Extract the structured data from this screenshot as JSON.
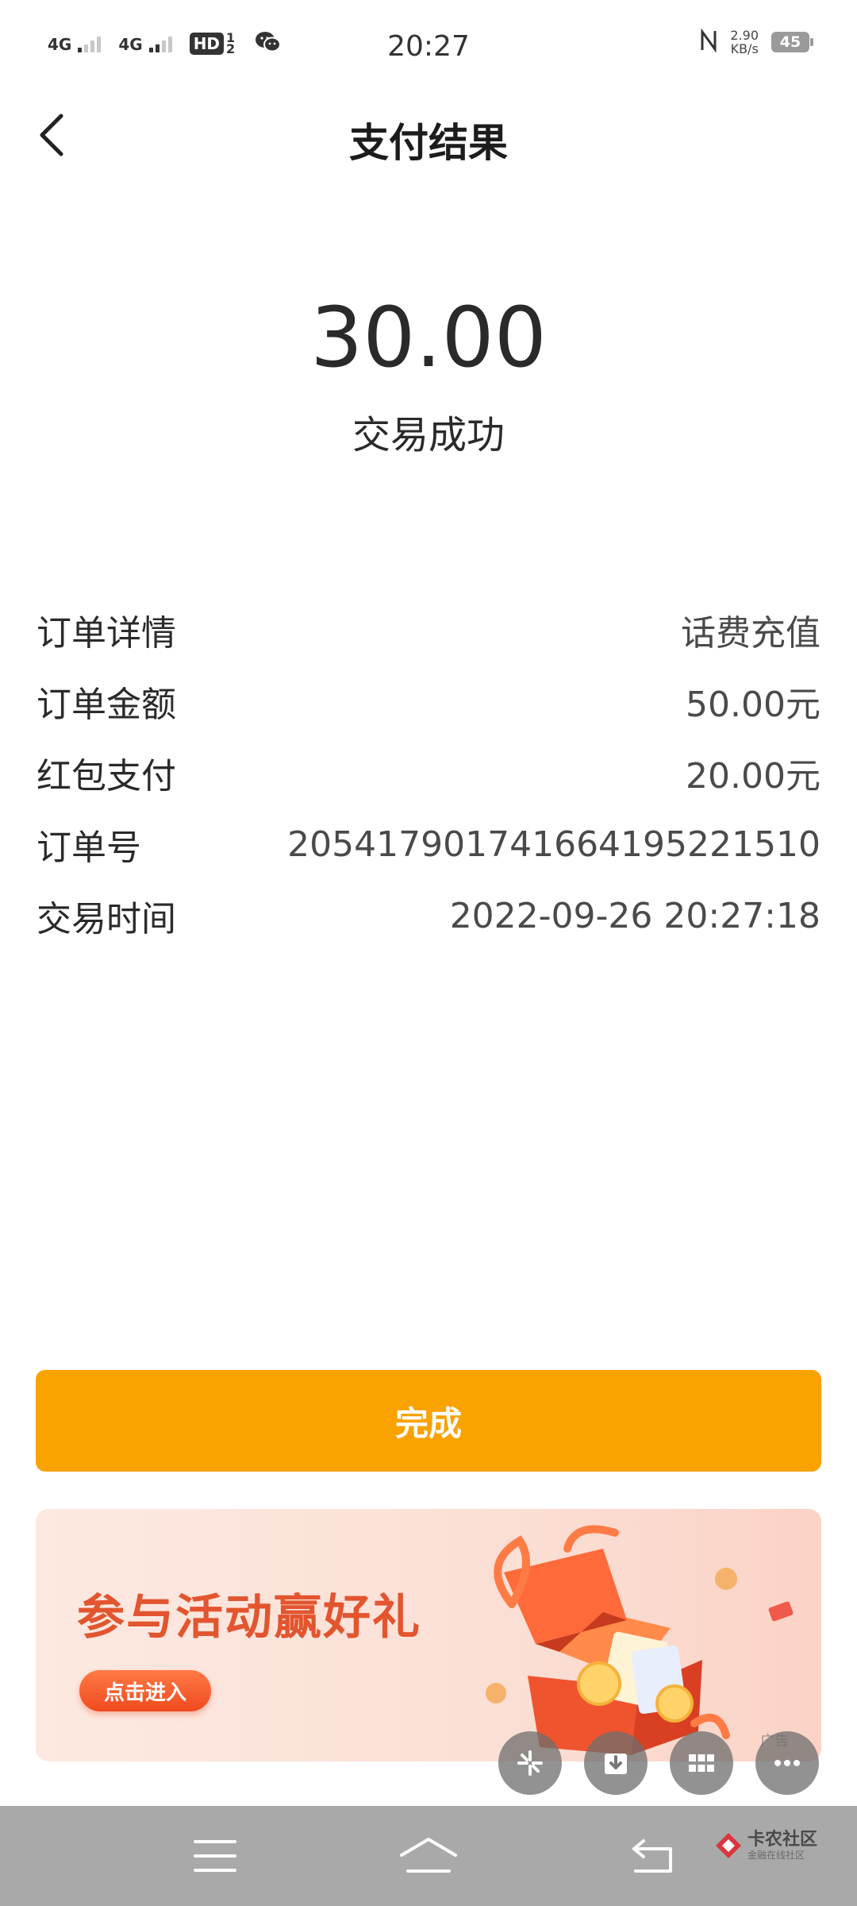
{
  "status_bar": {
    "signal1": "4G",
    "signal2": "4G",
    "hd_label": "HD",
    "hd_sub": "1 2",
    "time": "20:27",
    "net_speed_value": "2.90",
    "net_speed_unit": "KB/s",
    "battery_level": "45",
    "icons": [
      "signal-icon",
      "signal-icon",
      "hd-voice-icon",
      "wechat-icon",
      "nfc-icon",
      "battery-icon"
    ]
  },
  "header": {
    "title": "支付结果",
    "back_icon": "chevron-left-icon"
  },
  "payment": {
    "amount": "30.00",
    "status": "交易成功"
  },
  "details": [
    {
      "label": "订单详情",
      "value": "话费充值"
    },
    {
      "label": "订单金额",
      "value": "50.00元"
    },
    {
      "label": "红包支付",
      "value": "20.00元"
    },
    {
      "label": "订单号",
      "value": "2054179017416641952215​10"
    },
    {
      "label": "交易时间",
      "value": "2022-09-26 20:27:18"
    }
  ],
  "done_button": {
    "label": "完成",
    "color": "#F9A200"
  },
  "banner": {
    "headline": "参与活动赢好礼",
    "cta": "点击进入",
    "ad_tag": "广告",
    "headline_color": "#E2552F"
  },
  "floating_buttons": [
    "sparkle-icon",
    "download-icon",
    "grid-icon",
    "more-icon"
  ],
  "nav_bar": {
    "buttons": [
      "menu-icon",
      "home-icon",
      "back-icon"
    ]
  },
  "watermark": {
    "text": "卡农社区",
    "subtext": "金融在线社区"
  }
}
